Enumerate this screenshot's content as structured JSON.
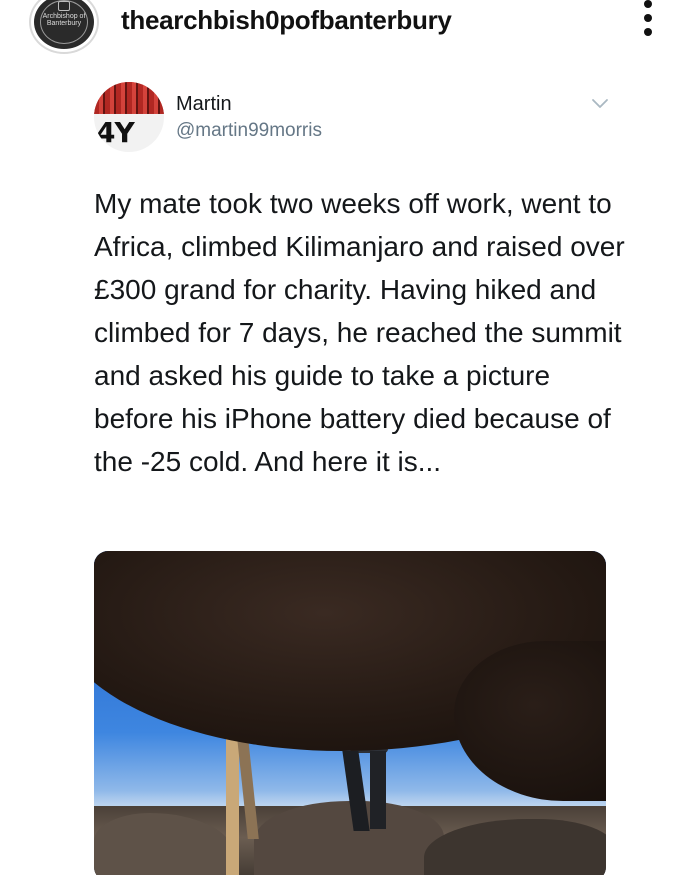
{
  "instagram": {
    "username": "thearchbish0pofbanterbury",
    "avatar_text": "Archbishop of Banterbury",
    "more_icon": "more-vertical-icon"
  },
  "tweet": {
    "name": "Martin",
    "handle": "@martin99morris",
    "avatar_text": "4Y",
    "chevron_icon": "chevron-down-icon",
    "text": "My mate took two weeks off work, went to Africa, climbed Kilimanjaro and raised over £300 grand for charity. Having hiked and climbed for 7 days, he reached the summit and asked his guide to take a picture before his iPhone battery died because of the -25 cold. And here it is..."
  },
  "colors": {
    "name": "#14171a",
    "handle": "#657786",
    "chevron": "#aab8c2"
  }
}
